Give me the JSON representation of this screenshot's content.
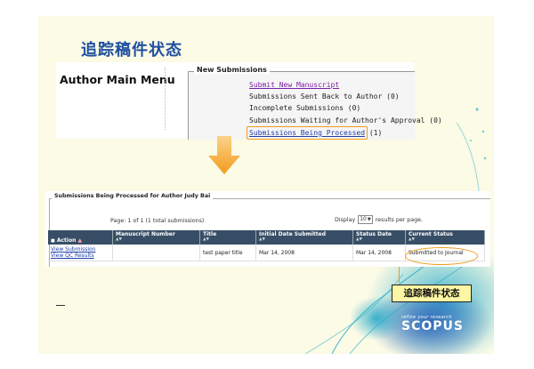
{
  "slide": {
    "title": "追踪稿件状态",
    "callout": "追踪稿件状态"
  },
  "author_menu": {
    "title": "Author Main Menu",
    "section_legend": "New Submissions",
    "items": [
      {
        "label": "Submit New Manuscript"
      },
      {
        "label": "Submissions Sent Back to Author (0)"
      },
      {
        "label": "Incomplete Submissions (0)"
      },
      {
        "label": "Submissions Waiting for Author's Approval (0)"
      },
      {
        "label": "Submissions Being Processed",
        "count": " (1)"
      }
    ]
  },
  "processing": {
    "panel_title": "Submissions Being Processed for Author Judy Bai",
    "page_info": "Page: 1 of 1 (1 total submissions)",
    "display_prefix": "Display",
    "display_value": "10",
    "display_suffix": "results per page.",
    "columns": [
      "Action",
      "Manuscript Number",
      "Title",
      "Initial Date Submitted",
      "Status Date",
      "Current Status"
    ],
    "row": {
      "action_1": "View Submission",
      "action_2": "View QC Results",
      "manuscript_number": "",
      "title": "test paper title",
      "initial_date": "Mar 14, 2008",
      "status_date": "Mar 14, 2008",
      "current_status": "Submitted to Journal"
    }
  },
  "branding": {
    "tagline": "refine your research",
    "name": "SCOPUS"
  },
  "colors": {
    "title_blue": "#1f4fa0",
    "highlight_orange": "#f29a1a",
    "table_header": "#374e66",
    "callout_yellow": "#fcf6a5",
    "link_purple": "#7a1fa2",
    "link_blue": "#1f3fa8"
  }
}
